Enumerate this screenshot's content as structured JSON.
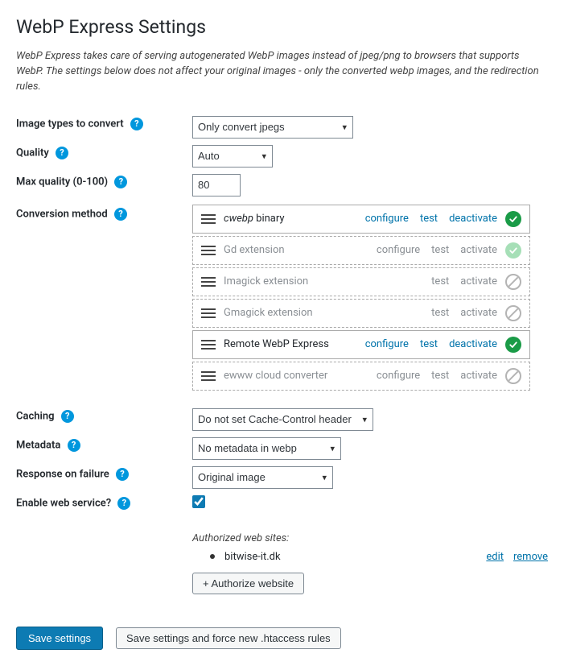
{
  "page": {
    "title": "WebP Express Settings",
    "intro": "WebP Express takes care of serving autogenerated WebP images instead of jpeg/png to browsers that supports WebP. The settings below does not affect your original images - only the converted webp images, and the redirection rules."
  },
  "labels": {
    "image_types": "Image types to convert",
    "quality": "Quality",
    "max_quality": "Max quality (0-100)",
    "conversion_method": "Conversion method",
    "caching": "Caching",
    "metadata": "Metadata",
    "response_on_failure": "Response on failure",
    "enable_web_service": "Enable web service?"
  },
  "selects": {
    "image_types": "Only convert jpegs",
    "quality": "Auto",
    "caching": "Do not set Cache-Control header",
    "metadata": "No metadata in webp",
    "response_on_failure": "Original image"
  },
  "inputs": {
    "max_quality": "80",
    "enable_web_service_checked": true
  },
  "converters": [
    {
      "label_html": "<span class='em'>cwebp</span> binary",
      "configure": true,
      "test": true,
      "toggle": "deactivate",
      "status": "ok",
      "dashed": false,
      "disabled": false
    },
    {
      "label_html": "Gd extension",
      "configure": true,
      "test": true,
      "toggle": "activate",
      "status": "ok-pale",
      "dashed": true,
      "disabled": true
    },
    {
      "label_html": "Imagick extension",
      "configure": false,
      "test": true,
      "toggle": "activate",
      "status": "na",
      "dashed": true,
      "disabled": true
    },
    {
      "label_html": "Gmagick extension",
      "configure": false,
      "test": true,
      "toggle": "activate",
      "status": "na",
      "dashed": true,
      "disabled": true
    },
    {
      "label_html": "Remote WebP Express",
      "configure": true,
      "test": true,
      "toggle": "deactivate",
      "status": "ok",
      "dashed": false,
      "disabled": false
    },
    {
      "label_html": "ewww cloud converter",
      "configure": true,
      "test": true,
      "toggle": "activate",
      "status": "na",
      "dashed": true,
      "disabled": true
    }
  ],
  "link_text": {
    "configure": "configure",
    "test": "test",
    "deactivate": "deactivate",
    "activate": "activate"
  },
  "web_service": {
    "auth_label": "Authorized web sites:",
    "sites": [
      {
        "name": "bitwise-it.dk"
      }
    ],
    "edit": "edit",
    "remove": "remove",
    "add_btn": "+ Authorize website"
  },
  "buttons": {
    "save": "Save settings",
    "save_force": "Save settings and force new .htaccess rules"
  }
}
